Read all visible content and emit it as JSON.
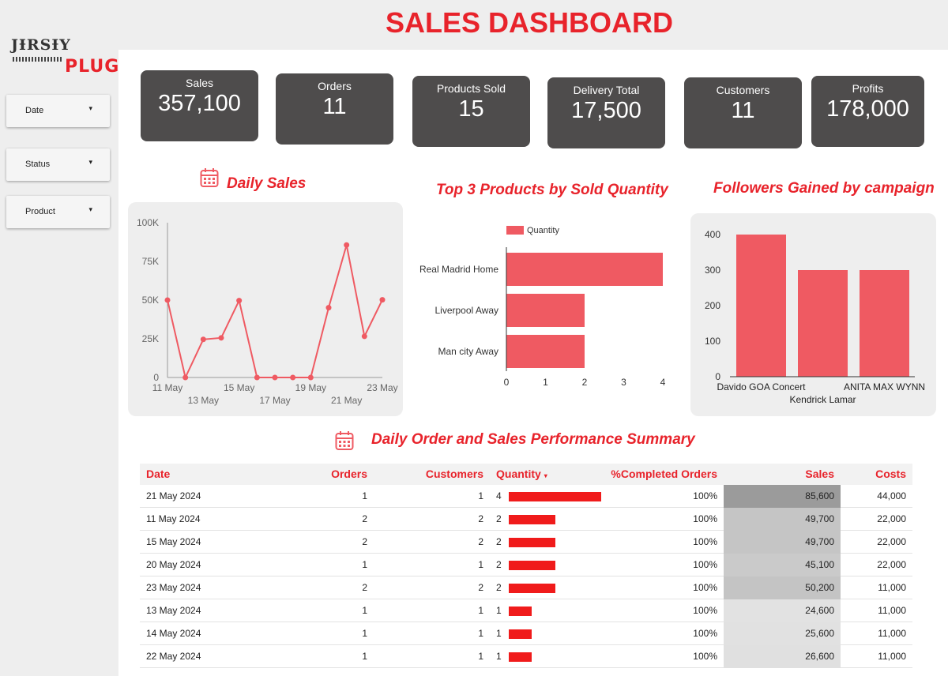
{
  "header": {
    "title": "SALES DASHBOARD"
  },
  "logo": {
    "line1": "JƗRSƗY",
    "line2": "PLUG"
  },
  "filters": [
    {
      "label": "Date",
      "caret": "▾"
    },
    {
      "label": "Status",
      "caret": "▾"
    },
    {
      "label": "Product",
      "caret": "▾"
    }
  ],
  "kpis": [
    {
      "label": "Sales",
      "value": "357,100"
    },
    {
      "label": "Orders",
      "value": "11"
    },
    {
      "label": "Products Sold",
      "value": "15"
    },
    {
      "label": "Delivery Total",
      "value": "17,500"
    },
    {
      "label": "Customers",
      "value": "11"
    },
    {
      "label": "Profits",
      "value": "178,000"
    }
  ],
  "colors": {
    "accent": "#e8232b",
    "bar": "#ef5a62",
    "card": "#4e4c4c",
    "table_bar": "#f01b1b"
  },
  "icons": {
    "section": "calendar-icon"
  },
  "chart_data": [
    {
      "type": "line",
      "title": "Daily Sales",
      "x": [
        "11 May",
        "12 May",
        "13 May",
        "14 May",
        "15 May",
        "16 May",
        "17 May",
        "18 May",
        "19 May",
        "20 May",
        "21 May",
        "22 May",
        "23 May"
      ],
      "values": [
        50000,
        0,
        24600,
        25600,
        49700,
        0,
        0,
        0,
        0,
        45100,
        85600,
        26600,
        50200
      ],
      "xtick_labels_top": [
        "11 May",
        "15 May",
        "19 May",
        "23 May"
      ],
      "xtick_labels_bottom": [
        "13 May",
        "17 May",
        "21 May"
      ],
      "ytick_labels": [
        "0",
        "25K",
        "50K",
        "75K",
        "100K"
      ],
      "ylim": [
        0,
        100000
      ],
      "grid": false
    },
    {
      "type": "bar",
      "orientation": "horizontal",
      "title": "Top 3 Products by Sold Quantity",
      "categories": [
        "Real Madrid Home",
        "Liverpool Away",
        "Man city Away"
      ],
      "series": [
        {
          "name": "Quantity",
          "values": [
            4,
            2,
            2
          ]
        }
      ],
      "xtick_labels": [
        "0",
        "1",
        "2",
        "3",
        "4"
      ],
      "xlim": [
        0,
        4
      ],
      "legend": "top"
    },
    {
      "type": "bar",
      "title": "Followers Gained by campaign",
      "categories": [
        "Davido GOA Concert",
        "Kendrick Lamar",
        "ANITA MAX WYNN"
      ],
      "values": [
        400,
        300,
        300
      ],
      "ytick_labels": [
        "0",
        "100",
        "200",
        "300",
        "400"
      ],
      "ylim": [
        0,
        400
      ]
    }
  ],
  "table": {
    "title": "Daily Order and Sales Performance Summary",
    "headers": {
      "date": "Date",
      "orders": "Orders",
      "customers": "Customers",
      "quantity": "Quantity",
      "sort": "▾",
      "completed": "%Completed Orders",
      "sales": "Sales",
      "costs": "Costs"
    },
    "rows": [
      {
        "date": "21 May 2024",
        "orders": "1",
        "customers": "1",
        "quantity": "4",
        "completed": "100%",
        "sales": "85,600",
        "costs": "44,000"
      },
      {
        "date": "11 May 2024",
        "orders": "2",
        "customers": "2",
        "quantity": "2",
        "completed": "100%",
        "sales": "49,700",
        "costs": "22,000"
      },
      {
        "date": "15 May 2024",
        "orders": "2",
        "customers": "2",
        "quantity": "2",
        "completed": "100%",
        "sales": "49,700",
        "costs": "22,000"
      },
      {
        "date": "20 May 2024",
        "orders": "1",
        "customers": "1",
        "quantity": "2",
        "completed": "100%",
        "sales": "45,100",
        "costs": "22,000"
      },
      {
        "date": "23 May 2024",
        "orders": "2",
        "customers": "2",
        "quantity": "2",
        "completed": "100%",
        "sales": "50,200",
        "costs": "11,000"
      },
      {
        "date": "13 May 2024",
        "orders": "1",
        "customers": "1",
        "quantity": "1",
        "completed": "100%",
        "sales": "24,600",
        "costs": "11,000"
      },
      {
        "date": "14 May 2024",
        "orders": "1",
        "customers": "1",
        "quantity": "1",
        "completed": "100%",
        "sales": "25,600",
        "costs": "11,000"
      },
      {
        "date": "22 May 2024",
        "orders": "1",
        "customers": "1",
        "quantity": "1",
        "completed": "100%",
        "sales": "26,600",
        "costs": "11,000"
      }
    ]
  }
}
